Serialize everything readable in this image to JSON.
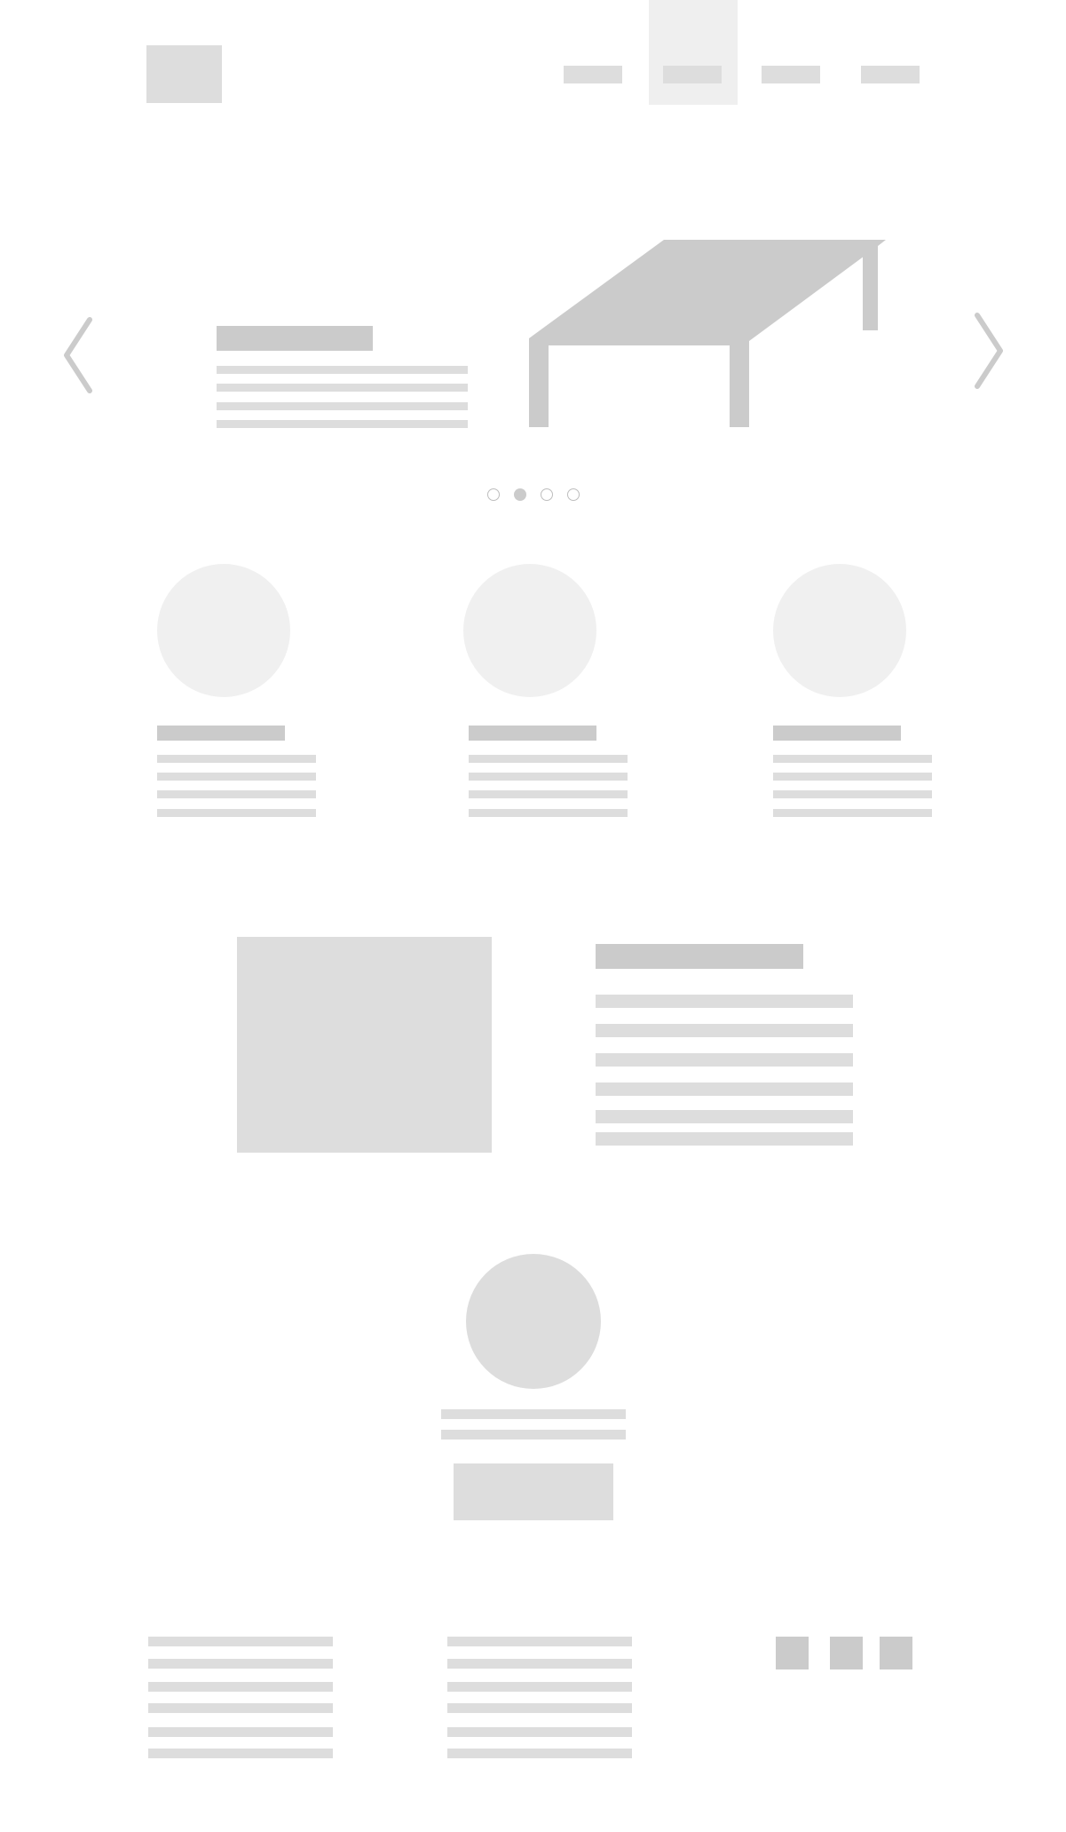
{
  "colors": {
    "section_bg": "#f0f0f0",
    "placeholder": "#dddddd",
    "dark": "#cbcbcb",
    "nav_active_bg": "#efefef",
    "white": "#ffffff"
  },
  "header": {
    "logo_icon": "logo-placeholder",
    "nav_items": [
      "",
      "",
      "",
      ""
    ],
    "active_nav_index": 1
  },
  "carousel": {
    "image_icon": "table-illustration",
    "prev_icon": "chevron-left",
    "next_icon": "chevron-right",
    "slide_count": 4,
    "active_slide_index": 1
  },
  "features": {
    "count": 3,
    "image_icon": "circle-placeholder"
  },
  "about": {
    "image_icon": "image-placeholder"
  },
  "profile": {
    "avatar_icon": "avatar-placeholder"
  },
  "footer": {
    "social_icons": [
      "social-icon",
      "social-icon",
      "social-icon"
    ]
  }
}
